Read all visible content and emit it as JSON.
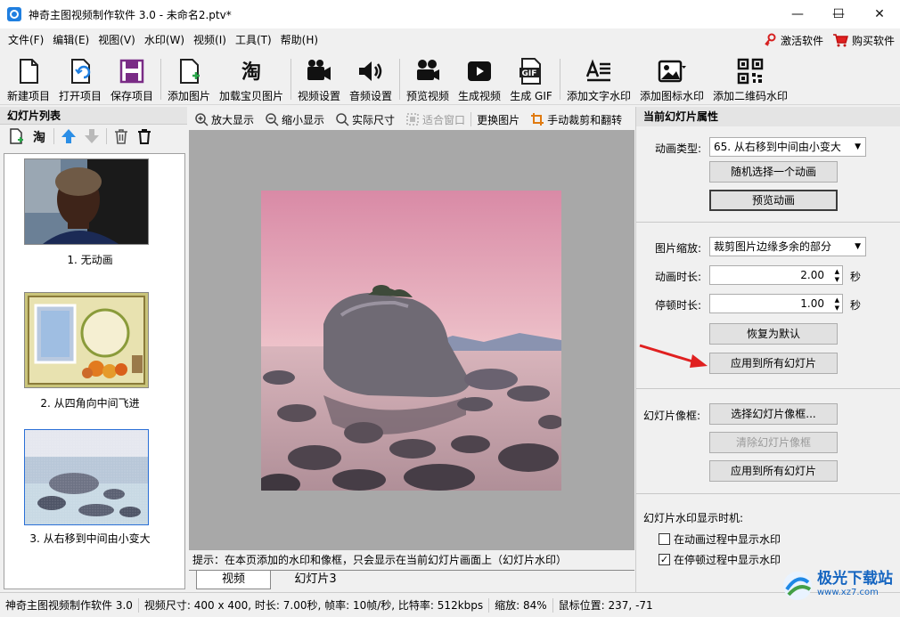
{
  "window": {
    "title": "神奇主图视频制作软件 3.0 - 未命名2.ptv*"
  },
  "menu": {
    "items": [
      "文件(F)",
      "编辑(E)",
      "视图(V)",
      "水印(W)",
      "视频(I)",
      "工具(T)",
      "帮助(H)"
    ],
    "activate": "激活软件",
    "buy": "购买软件"
  },
  "toolbar": {
    "new": "新建项目",
    "open": "打开项目",
    "save": "保存项目",
    "add_image": "添加图片",
    "load_taobao": "加载宝贝图片",
    "video_settings": "视频设置",
    "audio_settings": "音频设置",
    "preview_video": "预览视频",
    "gen_video": "生成视频",
    "gen_gif": "生成 GIF",
    "text_wm": "添加文字水印",
    "icon_wm": "添加图标水印",
    "qr_wm": "添加二维码水印",
    "gif_badge": "GIF",
    "tao_glyph": "淘"
  },
  "left_panel": {
    "title": "幻灯片列表",
    "slides": [
      {
        "label": "1. 无动画"
      },
      {
        "label": "2. 从四角向中间飞进"
      },
      {
        "label": "3. 从右移到中间由小变大"
      }
    ]
  },
  "canvas_toolbar": {
    "zoom_in": "放大显示",
    "zoom_out": "缩小显示",
    "actual": "实际尺寸",
    "fit": "适合窗口",
    "replace": "更换图片",
    "crop": "手动裁剪和翻转"
  },
  "tip": "提示：在本页添加的水印和像框，只会显示在当前幻灯片画面上（幻灯片水印）",
  "tabs": {
    "video": "视频",
    "slide": "幻灯片3"
  },
  "right_panel": {
    "title": "当前幻灯片属性",
    "anim_type_label": "动画类型:",
    "anim_type_value": "65. 从右移到中间由小变大",
    "random_btn": "随机选择一个动画",
    "preview_btn": "预览动画",
    "scale_label": "图片缩放:",
    "scale_value": "裁剪图片边缘多余的部分",
    "duration_label": "动画时长:",
    "duration_value": "2.00",
    "pause_label": "停顿时长:",
    "pause_value": "1.00",
    "sec": "秒",
    "reset_btn": "恢复为默认",
    "apply_all_btn": "应用到所有幻灯片",
    "frame_label": "幻灯片像框:",
    "select_frame_btn": "选择幻灯片像框...",
    "clear_frame_btn": "清除幻灯片像框",
    "apply_all_btn2": "应用到所有幻灯片",
    "wm_timing_label": "幻灯片水印显示时机:",
    "chk_anim": "在动画过程中显示水印",
    "chk_pause": "在停顿过程中显示水印",
    "chk_anim_checked": false,
    "chk_pause_checked": true
  },
  "status": {
    "app": "神奇主图视频制作软件 3.0",
    "info": "视频尺寸: 400 x 400, 时长: 7.00秒, 帧率: 10帧/秒, 比特率: 512kbps",
    "zoom": "缩放: 84%",
    "mouse": "鼠标位置: 237, -71"
  },
  "watermark": {
    "text": "极光下载站",
    "url": "www.xz7.com"
  }
}
